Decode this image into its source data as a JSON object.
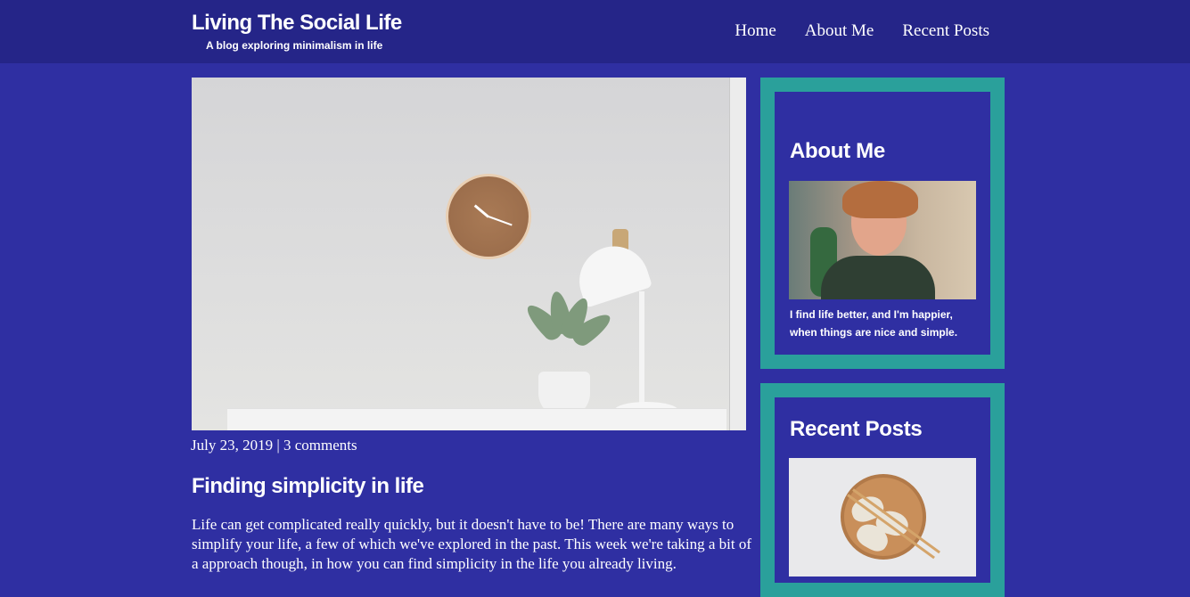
{
  "header": {
    "title": "Living The Social Life",
    "tagline": "A blog exploring minimalism in life",
    "nav": [
      "Home",
      "About Me",
      "Recent Posts"
    ]
  },
  "post": {
    "meta": "July 23, 2019 | 3 comments",
    "title": "Finding simplicity in life",
    "excerpt": "Life can get complicated really quickly, but it doesn't have to be! There are many ways to simplify your life, a few of which we've explored in the past. This week we're taking a bit of a approach though, in how you can find simplicity in the life you already living."
  },
  "sidebar": {
    "about": {
      "heading": "About Me",
      "text": "I find life better, and I'm happier, when things are nice and simple."
    },
    "recent": {
      "heading": "Recent Posts"
    }
  },
  "colors": {
    "background": "#2f2fa2",
    "header": "#252588",
    "card_border": "#2aa09b"
  },
  "icons": {
    "hero": "clock-plant-lamp-image",
    "about": "smiling-man-photo",
    "recent": "dumplings-bowl-photo"
  }
}
